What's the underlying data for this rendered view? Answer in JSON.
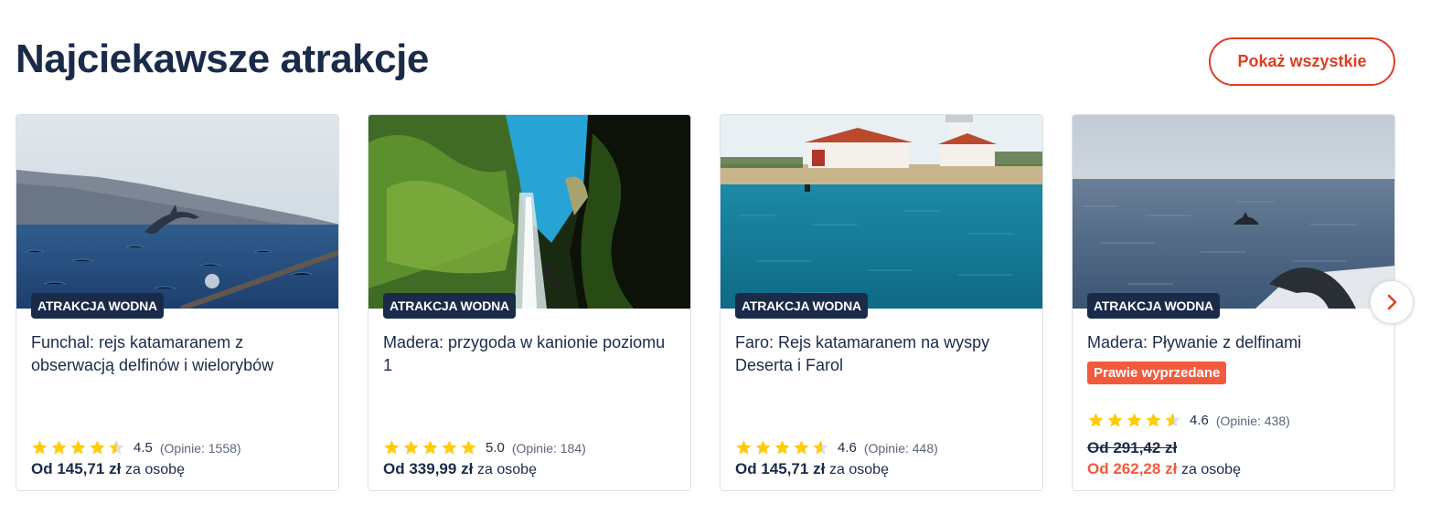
{
  "header": {
    "title": "Najciekawsze atrakcje",
    "show_all_label": "Pokaż wszystkie"
  },
  "cards": [
    {
      "image": "dolphin-jumping-sea-photo",
      "badge": "ATRAKCJA WODNA",
      "title": "Funchal: rejs katamaranem z obserwacją delfinów i wielorybów",
      "rating": 4.5,
      "rating_text": "4.5",
      "reviews": "(Opinie: 1558)",
      "price_prefix": "Od",
      "price": "145,71 zł",
      "price_suffix": "za osobę"
    },
    {
      "image": "canyon-waterfall-rappel-photo",
      "badge": "ATRAKCJA WODNA",
      "title": "Madera: przygoda w kanionie poziomu 1",
      "rating": 5.0,
      "rating_text": "5.0",
      "reviews": "(Opinie: 184)",
      "price_prefix": "Od",
      "price": "339,99 zł",
      "price_suffix": "za osobę"
    },
    {
      "image": "lighthouse-island-sea-photo",
      "badge": "ATRAKCJA WODNA",
      "title": "Faro: Rejs katamaranem na wyspy Deserta i Farol",
      "rating": 4.6,
      "rating_text": "4.6",
      "reviews": "(Opinie: 448)",
      "price_prefix": "Od",
      "price": "145,71 zł",
      "price_suffix": "za osobę"
    },
    {
      "image": "dolphin-sea-boat-photo",
      "badge": "ATRAKCJA WODNA",
      "title": "Madera: Pływanie z delfinami",
      "label": "Prawie wyprzedane",
      "rating": 4.6,
      "rating_text": "4.6",
      "reviews": "(Opinie: 438)",
      "old_price": "Od 291,42 zł",
      "price_prefix": "Od",
      "price": "262,28 zł",
      "price_suffix": "za osobę"
    }
  ],
  "carousel": {
    "next_icon": "chevron-right-icon"
  },
  "colors": {
    "accent": "#dc3f22",
    "navy": "#1a2b49",
    "sale": "#f25a3e",
    "star": "#fdcc0d"
  }
}
